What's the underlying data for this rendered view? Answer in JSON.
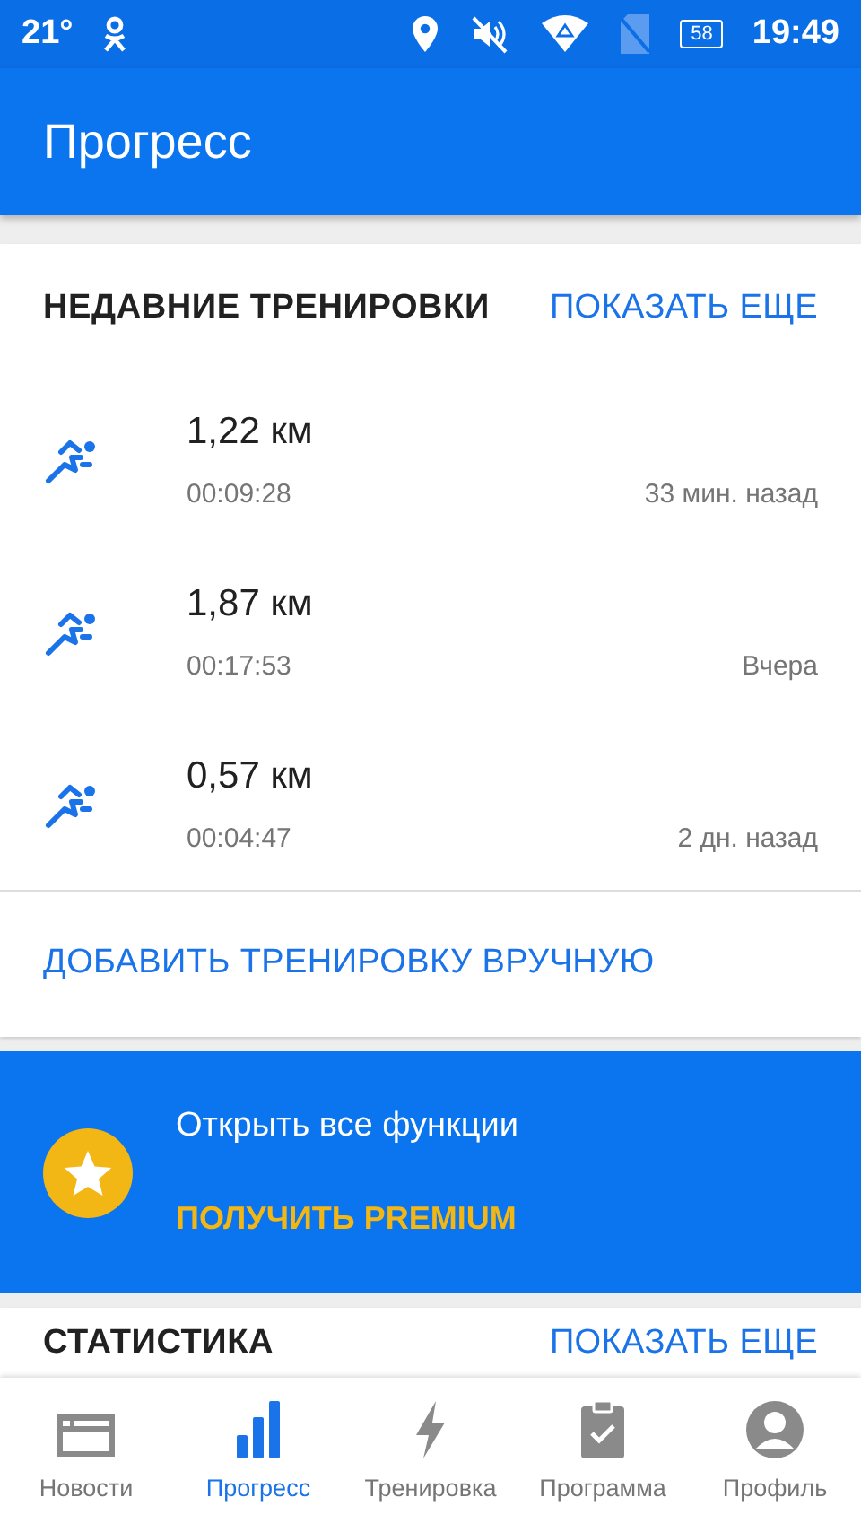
{
  "status_bar": {
    "temperature": "21°",
    "battery": "58",
    "time": "19:49"
  },
  "app_bar": {
    "title": "Прогресс"
  },
  "recent": {
    "title": "НЕДАВНИЕ ТРЕНИРОВКИ",
    "more_link": "ПОКАЗАТЬ ЕЩЕ",
    "workouts": [
      {
        "distance": "1,22 км",
        "duration": "00:09:28",
        "when": "33 мин. назад"
      },
      {
        "distance": "1,87 км",
        "duration": "00:17:53",
        "when": "Вчера"
      },
      {
        "distance": "0,57 км",
        "duration": "00:04:47",
        "when": "2 дн. назад"
      }
    ],
    "add_link": "ДОБАВИТЬ ТРЕНИРОВКУ ВРУЧНУЮ"
  },
  "premium": {
    "text": "Открыть все функции",
    "button": "ПОЛУЧИТЬ PREMIUM"
  },
  "stats": {
    "title": "СТАТИСТИКА",
    "more_link": "ПОКАЗАТЬ ЕЩЕ"
  },
  "nav": {
    "items": [
      {
        "label": "Новости",
        "selected": false
      },
      {
        "label": "Прогресс",
        "selected": true
      },
      {
        "label": "Тренировка",
        "selected": false
      },
      {
        "label": "Программа",
        "selected": false
      },
      {
        "label": "Профиль",
        "selected": false
      }
    ]
  }
}
